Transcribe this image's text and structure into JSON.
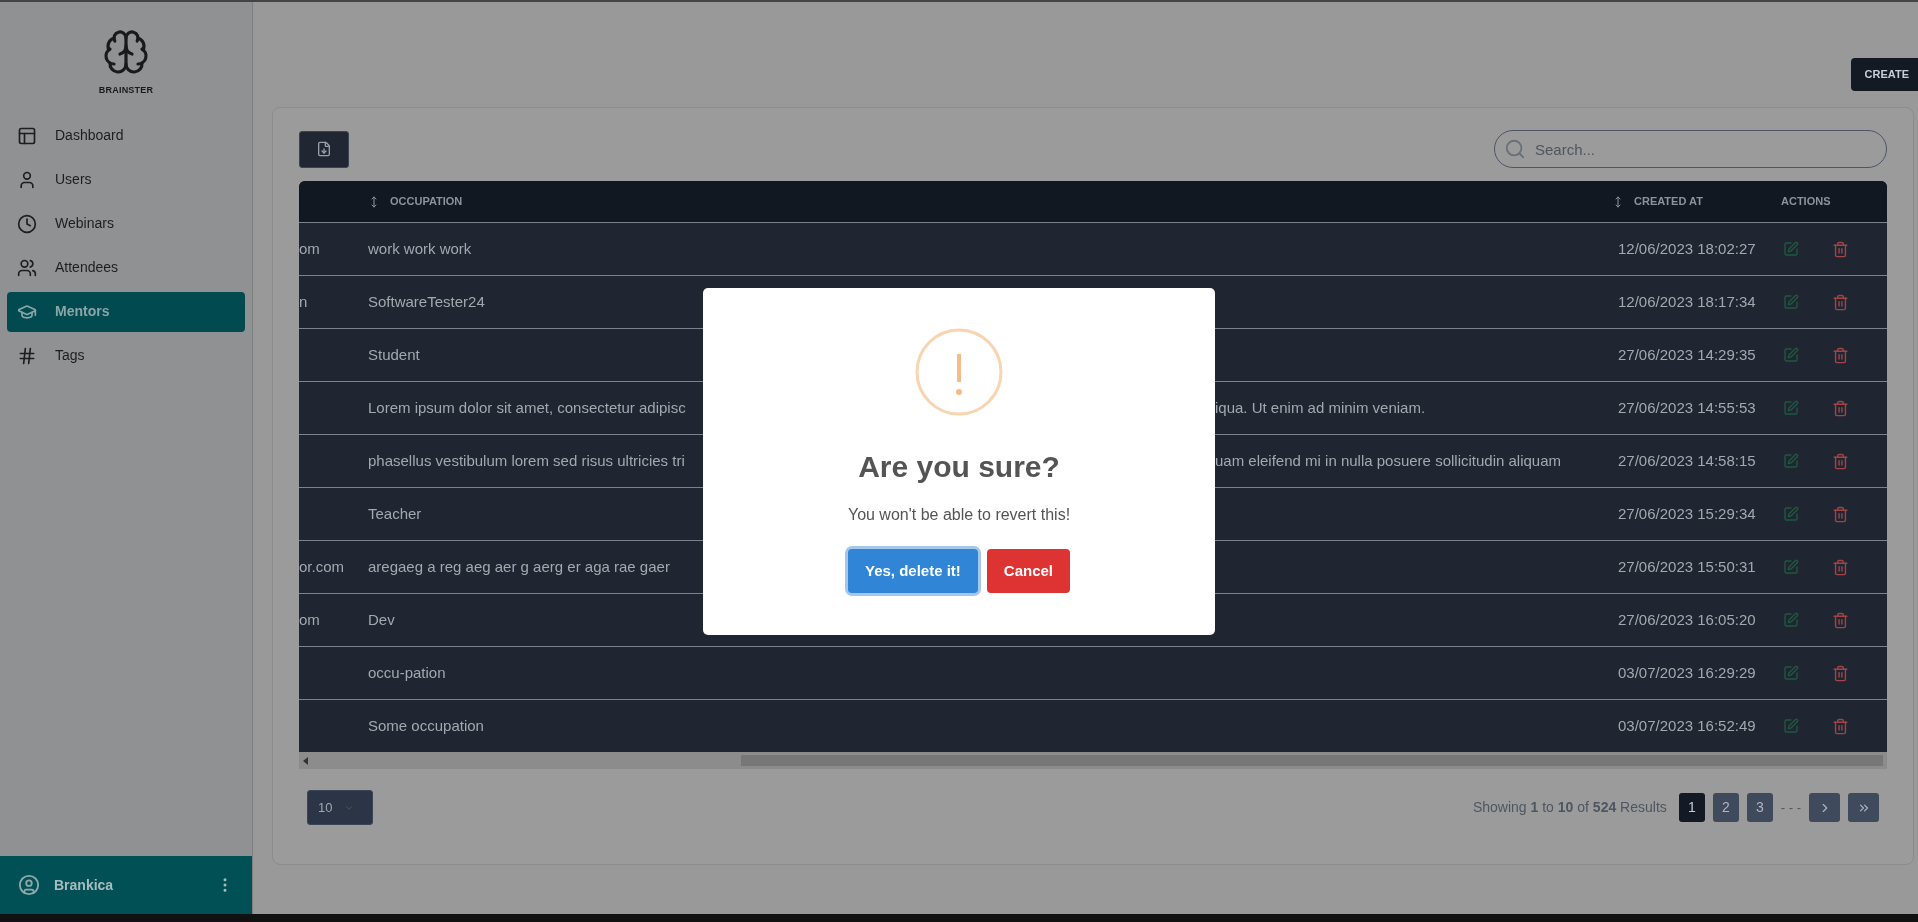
{
  "sidebar": {
    "logo_text": "BRAINSTER",
    "items": [
      {
        "label": "Dashboard",
        "selected": false
      },
      {
        "label": "Users",
        "selected": false
      },
      {
        "label": "Webinars",
        "selected": false
      },
      {
        "label": "Attendees",
        "selected": false
      },
      {
        "label": "Mentors",
        "selected": true
      },
      {
        "label": "Tags",
        "selected": false
      }
    ],
    "user": {
      "name": "Brankica"
    }
  },
  "header": {
    "create_button": "CREATE"
  },
  "search": {
    "placeholder": "Search..."
  },
  "table": {
    "columns": [
      {
        "label": "OCCUPATION",
        "sortable": true
      },
      {
        "label": "CREATED AT",
        "sortable": true
      },
      {
        "label": "ACTIONS",
        "sortable": false
      }
    ],
    "rows": [
      {
        "column_1": "om",
        "occupation": "work work work",
        "created_at": "12/06/2023 18:02:27"
      },
      {
        "column_1": "n",
        "occupation": "SoftwareTester24",
        "created_at": "12/06/2023 18:17:34"
      },
      {
        "occupation": "Student",
        "created_at": "27/06/2023 14:29:35"
      },
      {
        "occupation_parts": [
          "Lorem ipsum dolor sit amet, consectetur adipisc",
          "iqua. Ut enim ad minim veniam."
        ],
        "created_at": "27/06/2023 14:55:53"
      },
      {
        "occupation_parts": [
          "phasellus vestibulum lorem sed risus ultricies tri",
          "uam eleifend mi in nulla posuere sollicitudin aliquam"
        ],
        "created_at": "27/06/2023 14:58:15"
      },
      {
        "occupation": "Teacher",
        "created_at": "27/06/2023 15:29:34"
      },
      {
        "column_1": "or.com",
        "occupation": "aregaeg a reg aeg aer g aerg er aga rae gaer",
        "created_at": "27/06/2023 15:50:31"
      },
      {
        "column_1": "om",
        "occupation": "Dev",
        "created_at": "27/06/2023 16:05:20"
      },
      {
        "occupation": "occu-pation",
        "created_at": "03/07/2023 16:29:29"
      },
      {
        "occupation": "Some occupation",
        "created_at": "03/07/2023 16:52:49"
      }
    ]
  },
  "pagination": {
    "page_size": "10",
    "summary": "Showing **1** to **10** of **524** Results",
    "pages": [
      {
        "label": "1",
        "selected": true
      },
      {
        "label": "2",
        "selected": false
      },
      {
        "label": "3",
        "selected": false
      }
    ],
    "ellipsis": "- - -"
  },
  "modal": {
    "title": "Are you sure?",
    "message": "You won't be able to revert this!",
    "confirm": "Yes, delete it!",
    "cancel": "Cancel"
  }
}
